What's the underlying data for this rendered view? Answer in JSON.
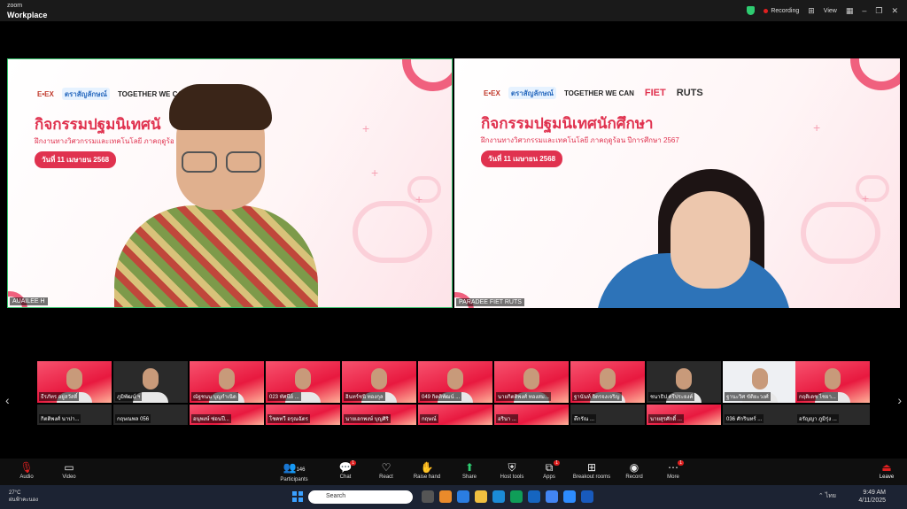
{
  "app": {
    "brand_small": "zoom",
    "brand_name": "Workplace",
    "recording_label": "Recording",
    "view_label": "View"
  },
  "slide": {
    "title": "กิจกรรมปฐมนิเทศนักศึกษา",
    "subtitle": "ฝึกงานทางวิศวกรรมและเทคโนโลยี ภาคฤดูร้อน ปีการศึกษา 2567",
    "date": "วันที่ 11 เมษายน 2568",
    "logos": [
      "E•EX",
      "ตราสัญลักษณ์",
      "TOGETHER WE CAN",
      "FIET",
      "RUTS"
    ],
    "title_partial": "กิจกรรมปฐมนิเทศนั",
    "subtitle_partial": "ฝึกงานทางวิศวกรรมและเทคโนโลยี ภาคฤดูร้อ"
  },
  "speakers": [
    {
      "name": "AUAILEE H"
    },
    {
      "name": "PARADEE FIET RUTS"
    }
  ],
  "gallery": {
    "row1": [
      "ธีรภัทร อยู่สวัสดิ์",
      "ภูมิพัฒน์ ฯ",
      "ณัฐชนน บุญกำเนิด",
      "023 ทัศนีย์ ...",
      "อินทร์ชนิ ทองกุล",
      "049 กิตติพัฒน์ ...",
      "นายกิตติพงศ์ ทองสม...",
      "ฐานันท์ จิตรจงเจริญ",
      "ชนาธิป ศรีประยงค์",
      "ฐานะวิศ ขัติยะวงศ์",
      "กฤติเดช ไชยา..."
    ],
    "row2": [
      "กิตติพงศ์ นาปา...",
      "กฤษณพล 056",
      "อนุพงษ์ ซ่อนปี...",
      "โชคทวี อรุณฉัตร",
      "นายเอกพงษ์ บุญศิริ",
      "กฤษณ์",
      "อรินา ...",
      "ตึกรัณ ...",
      "นายสุรศักดิ์ ...",
      "036 ศักรินทร์ ...",
      "อรัญญา ภูมิรุ่ง ..."
    ]
  },
  "toolbar": {
    "audio": "Audio",
    "video": "Video",
    "participants": "Participants",
    "participants_count": "146",
    "chat": "Chat",
    "react": "React",
    "raise_hand": "Raise hand",
    "share": "Share",
    "host_tools": "Host tools",
    "apps": "Apps",
    "breakout": "Breakout rooms",
    "record": "Record",
    "more": "More",
    "leave": "Leave",
    "chat_badge": "1",
    "apps_badge": "1",
    "more_badge": "1"
  },
  "taskbar": {
    "temp": "27°C",
    "weather": "ฝนฟ้าคะนอง",
    "search_placeholder": "Search",
    "lang": "ไทย",
    "time": "9:49 AM",
    "date": "4/11/2025",
    "badge": "4"
  }
}
